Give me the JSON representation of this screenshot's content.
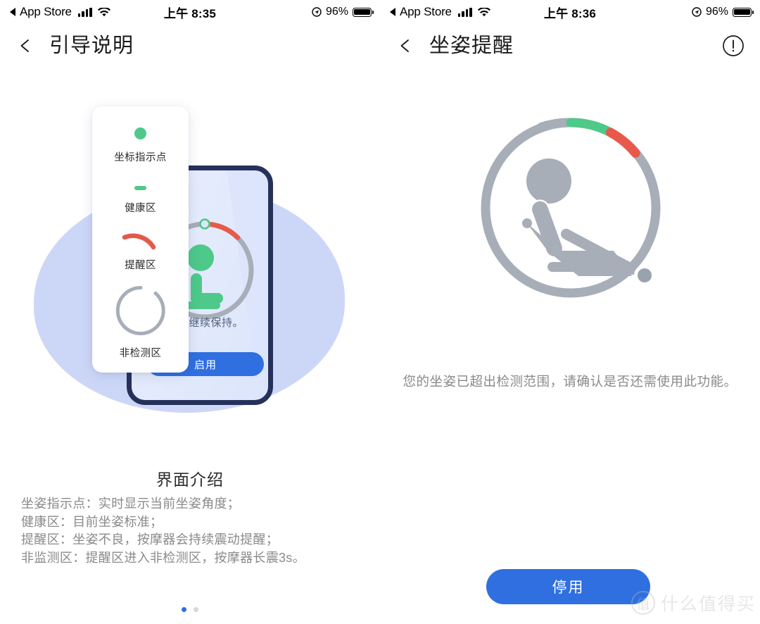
{
  "colors": {
    "accent_blue": "#2f6fe0",
    "healthy_green": "#4ec98a",
    "alert_red": "#e8594a",
    "inactive_gray": "#a7aeb8",
    "blob_lavender": "#ccd7f8",
    "phone_frame": "#26315b",
    "phone_screen": "#dce5fb"
  },
  "left_screen": {
    "status_bar": {
      "back_app_label": "App Store",
      "signal_icon": "cellular-bars-icon",
      "wifi_icon": "wifi-icon",
      "time": "上午 8:35",
      "location_icon": "location-arrow-icon",
      "battery_percent": "96%",
      "battery_icon": "battery-full-icon"
    },
    "header": {
      "back_icon": "arrow-left-icon",
      "title": "引导说明"
    },
    "legend_card": {
      "items": [
        {
          "icon": "green-dot-icon",
          "label": "坐标指示点"
        },
        {
          "icon": "green-bar-icon",
          "label": "健康区"
        },
        {
          "icon": "red-arc-icon",
          "label": "提醒区"
        },
        {
          "icon": "gray-ring-icon",
          "label": "非检测区"
        }
      ]
    },
    "phone_mockup": {
      "gauge_icon": "posture-gauge-icon",
      "caption": "准，请继续保持。",
      "enable_button": "启用"
    },
    "intro": {
      "title": "界面介绍",
      "lines": [
        "坐姿指示点：实时显示当前坐姿角度；",
        "健康区：目前坐姿标准；",
        "提醒区：坐姿不良，按摩器会持续震动提醒；",
        "非监测区：提醒区进入非检测区，按摩器长震3s。"
      ]
    },
    "pager": {
      "total": 2,
      "active_index": 0
    }
  },
  "right_screen": {
    "status_bar": {
      "back_app_label": "App Store",
      "signal_icon": "cellular-bars-icon",
      "wifi_icon": "wifi-icon",
      "time": "上午 8:36",
      "location_icon": "location-arrow-icon",
      "battery_percent": "96%",
      "battery_icon": "battery-full-icon"
    },
    "header": {
      "back_icon": "arrow-left-icon",
      "title": "坐姿提醒",
      "info_icon": "exclamation-circle-icon"
    },
    "gauge": {
      "icon": "posture-gauge-icon",
      "track_color": "#a7aeb8",
      "healthy_arc_color": "#4ec98a",
      "alert_arc_color": "#e8594a",
      "indicator_position": "bottom-right-outside-range"
    },
    "description": "您的坐姿已超出检测范围，请确认是否还需使用此功能。",
    "primary_button": "停用"
  },
  "watermark": {
    "logo_glyph": "值",
    "text": "什么值得买"
  }
}
